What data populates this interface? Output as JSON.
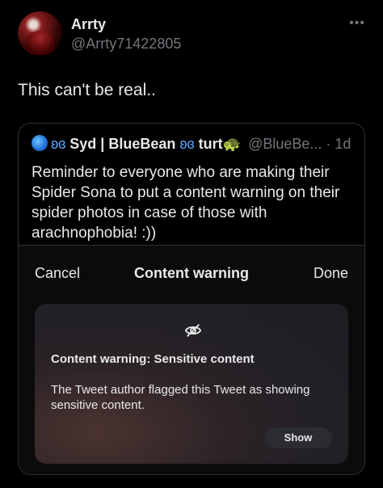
{
  "author": {
    "display_name": "Arrty",
    "handle": "@Arrty71422805",
    "more_icon": "more-dots-icon"
  },
  "tweet": {
    "text": "This can't be real.."
  },
  "quoted": {
    "name": "Syd | BlueBean",
    "name_suffix": "turt",
    "handle_time": "@BlueBe... · 1d",
    "body": "Reminder to everyone who are making their Spider Sona to put a content warning on their spider photos in case of those with arachnophobia! :))"
  },
  "sheet": {
    "cancel_label": "Cancel",
    "title": "Content warning",
    "done_label": "Done"
  },
  "warning": {
    "icon": "eye-slash-icon",
    "title": "Content warning: Sensitive content",
    "body": "The Tweet author flagged this Tweet as showing sensitive content.",
    "show_label": "Show"
  }
}
